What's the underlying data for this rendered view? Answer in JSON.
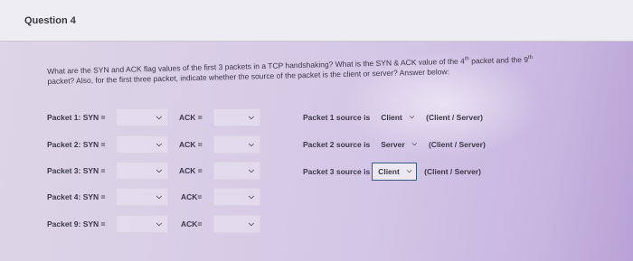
{
  "question": {
    "title": "Question 4",
    "prompt_line1_a": "What are the SYN and ACK flag values of the first 3 packets in a TCP handshaking? What is the SYN & ACK value of the 4",
    "prompt_sup1": "th",
    "prompt_line1_b": " packet and the 9",
    "prompt_sup2": "th",
    "prompt_line2": "packet? Also, for the first three packet, indicate whether the source of the packet is the client or server? Answer below:"
  },
  "rows": [
    {
      "syn_label": "Packet 1: SYN =",
      "ack_label": "ACK ="
    },
    {
      "syn_label": "Packet 2: SYN =",
      "ack_label": "ACK ="
    },
    {
      "syn_label": "Packet 3: SYN =",
      "ack_label": "ACK ="
    },
    {
      "syn_label": "Packet 4: SYN =",
      "ack_label": "ACK="
    },
    {
      "syn_label": "Packet 9: SYN =",
      "ack_label": "ACK="
    }
  ],
  "sources": [
    {
      "label": "Packet 1 source is",
      "value": "Client",
      "hint": "(Client / Server)"
    },
    {
      "label": "Packet 2 source is",
      "value": "Server",
      "hint": "(Client / Server)"
    },
    {
      "label": "Packet 3 source is",
      "value": "Client",
      "hint": "(Client / Server)"
    }
  ],
  "icons": {
    "dropdown": "chevron-down-icon"
  },
  "colors": {
    "focus_border": "#3a5a82",
    "header_bg": "#eeeef2"
  }
}
